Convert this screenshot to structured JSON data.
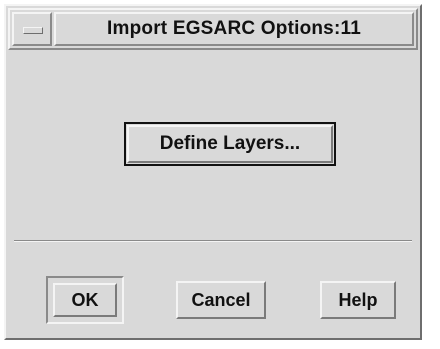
{
  "window": {
    "title": "Import EGSARC Options:11",
    "menu_icon": "window-menu-icon"
  },
  "main": {
    "define_layers_label": "Define Layers..."
  },
  "footer": {
    "ok_label": "OK",
    "cancel_label": "Cancel",
    "help_label": "Help"
  },
  "colors": {
    "background": "#d9d9d9",
    "highlight": "#f4f4f4",
    "shadow": "#7a7a7a",
    "text": "#111111"
  }
}
